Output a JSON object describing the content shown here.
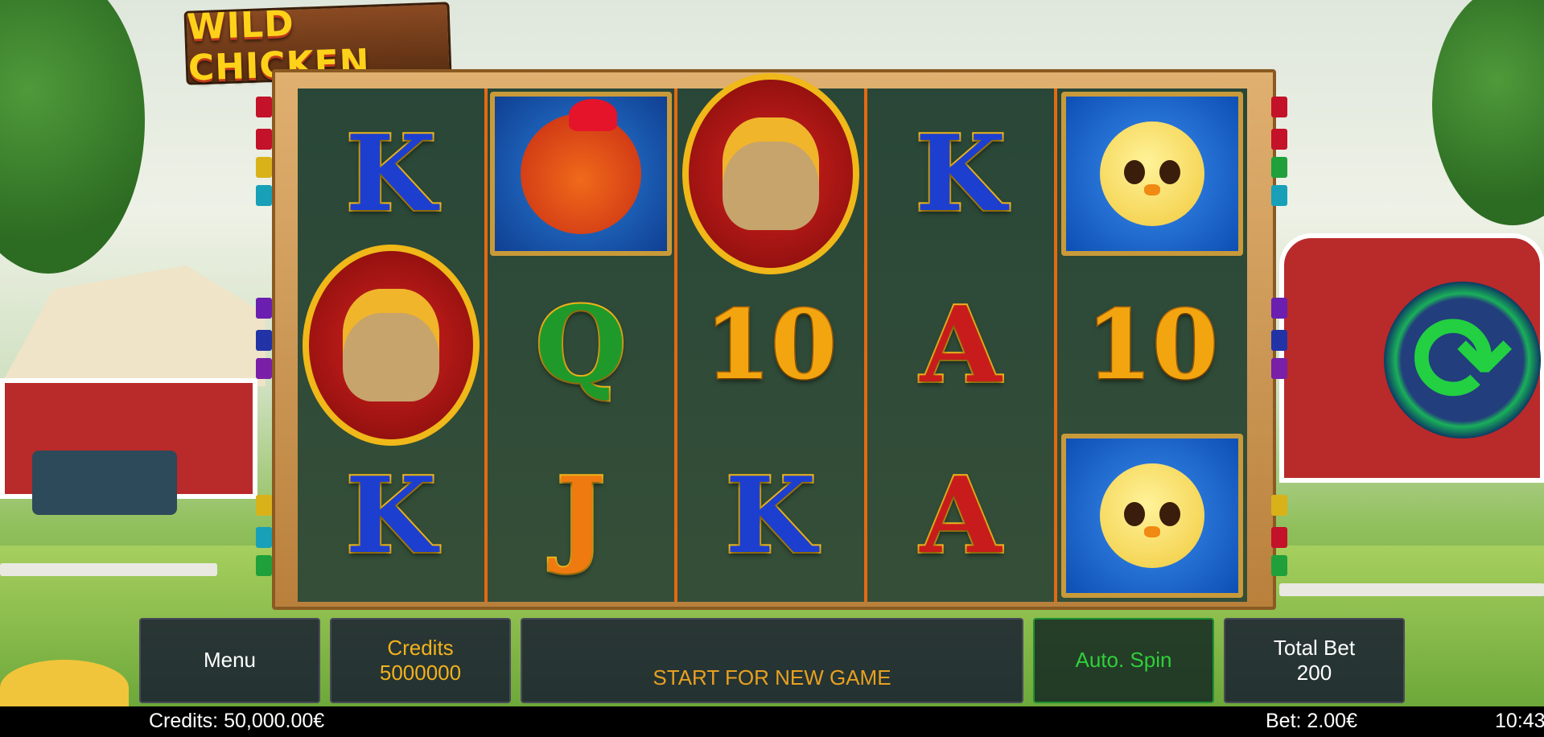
{
  "game": {
    "title": "WILD CHICKEN"
  },
  "reels": [
    [
      "K",
      "sack",
      "K"
    ],
    [
      "rooster",
      "Q",
      "J"
    ],
    [
      "sack",
      "10",
      "K"
    ],
    [
      "K",
      "A",
      "A"
    ],
    [
      "chick",
      "10",
      "chick"
    ]
  ],
  "controls": {
    "menu_label": "Menu",
    "credits_label": "Credits",
    "credits_value": "5000000",
    "message": "START FOR NEW GAME",
    "auto_spin_label": "Auto. Spin",
    "total_bet_label": "Total Bet",
    "total_bet_value": "200"
  },
  "status": {
    "credits": "Credits: 50,000.00€",
    "bet": "Bet: 2.00€",
    "time": "10:43"
  },
  "colors": {
    "spin_arrow": "#22d042",
    "message_text": "#e8a020",
    "auto_spin_text": "#2fcf3a",
    "credits_text": "#f2b21c"
  },
  "icons": {
    "spin": "spin-arrows-icon"
  }
}
